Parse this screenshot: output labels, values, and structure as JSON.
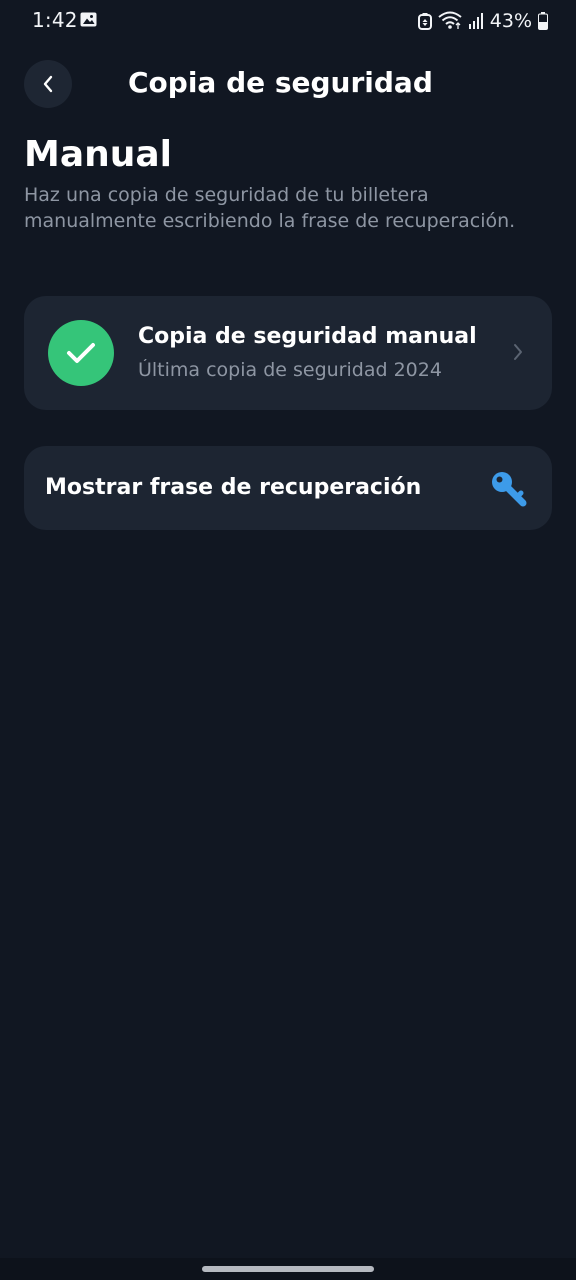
{
  "status_bar": {
    "time": "1:42",
    "battery_percent": "43%",
    "icons": [
      "gallery-icon",
      "alarm-icon",
      "wifi-icon",
      "signal-icon",
      "battery-icon"
    ]
  },
  "header": {
    "title": "Copia de seguridad",
    "back_icon": "chevron-left-icon"
  },
  "section": {
    "title": "Manual",
    "description": "Haz una copia de seguridad de tu billetera manualmente escribiendo la frase de recuperación."
  },
  "backup_card": {
    "title": "Copia de seguridad manual",
    "subtitle": "Última copia de seguridad 2024",
    "status_icon": "check-icon",
    "status_color": "#35c579",
    "nav_icon": "chevron-right-icon"
  },
  "recovery_card": {
    "label": "Mostrar frase de recuperación",
    "icon": "key-icon",
    "icon_color": "#3d9be9"
  },
  "colors": {
    "background": "#111722",
    "card": "#1d2532",
    "muted_text": "#8e96a3"
  }
}
